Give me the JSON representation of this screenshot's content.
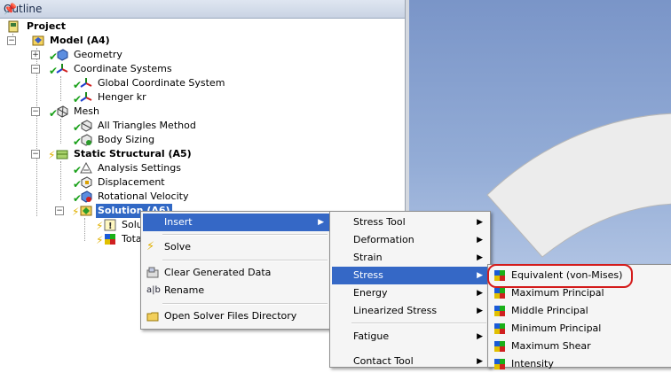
{
  "outline": {
    "title": "Outline",
    "pin": "ᵖ"
  },
  "tree": {
    "project": "Project",
    "model": "Model (A4)",
    "geometry": "Geometry",
    "coord_systems": "Coordinate Systems",
    "global_cs": "Global Coordinate System",
    "henger": "Henger kr",
    "mesh": "Mesh",
    "all_triangles": "All Triangles Method",
    "body_sizing": "Body Sizing",
    "static_structural": "Static Structural (A5)",
    "analysis_settings": "Analysis Settings",
    "displacement": "Displacement",
    "rotational_velocity": "Rotational Velocity",
    "solution": "Solution (A6)",
    "solution_info": "Solu",
    "total": "Tota"
  },
  "context_menu": {
    "insert": "Insert",
    "solve": "Solve",
    "clear": "Clear Generated Data",
    "rename": "Rename",
    "open_dir": "Open Solver Files Directory"
  },
  "insert_menu": {
    "stress_tool": "Stress Tool",
    "deformation": "Deformation",
    "strain": "Strain",
    "stress": "Stress",
    "energy": "Energy",
    "linearized_stress": "Linearized Stress",
    "fatigue": "Fatigue",
    "contact_tool": "Contact Tool"
  },
  "stress_menu": {
    "equivalent": "Equivalent (von-Mises)",
    "max_principal": "Maximum Principal",
    "mid_principal": "Middle Principal",
    "min_principal": "Minimum Principal",
    "max_shear": "Maximum Shear",
    "intensity": "Intensity"
  },
  "colors": {
    "highlight": "#3568c6",
    "selection": "#3168c5",
    "ring": "#d41c1c",
    "check": "#19a019"
  }
}
